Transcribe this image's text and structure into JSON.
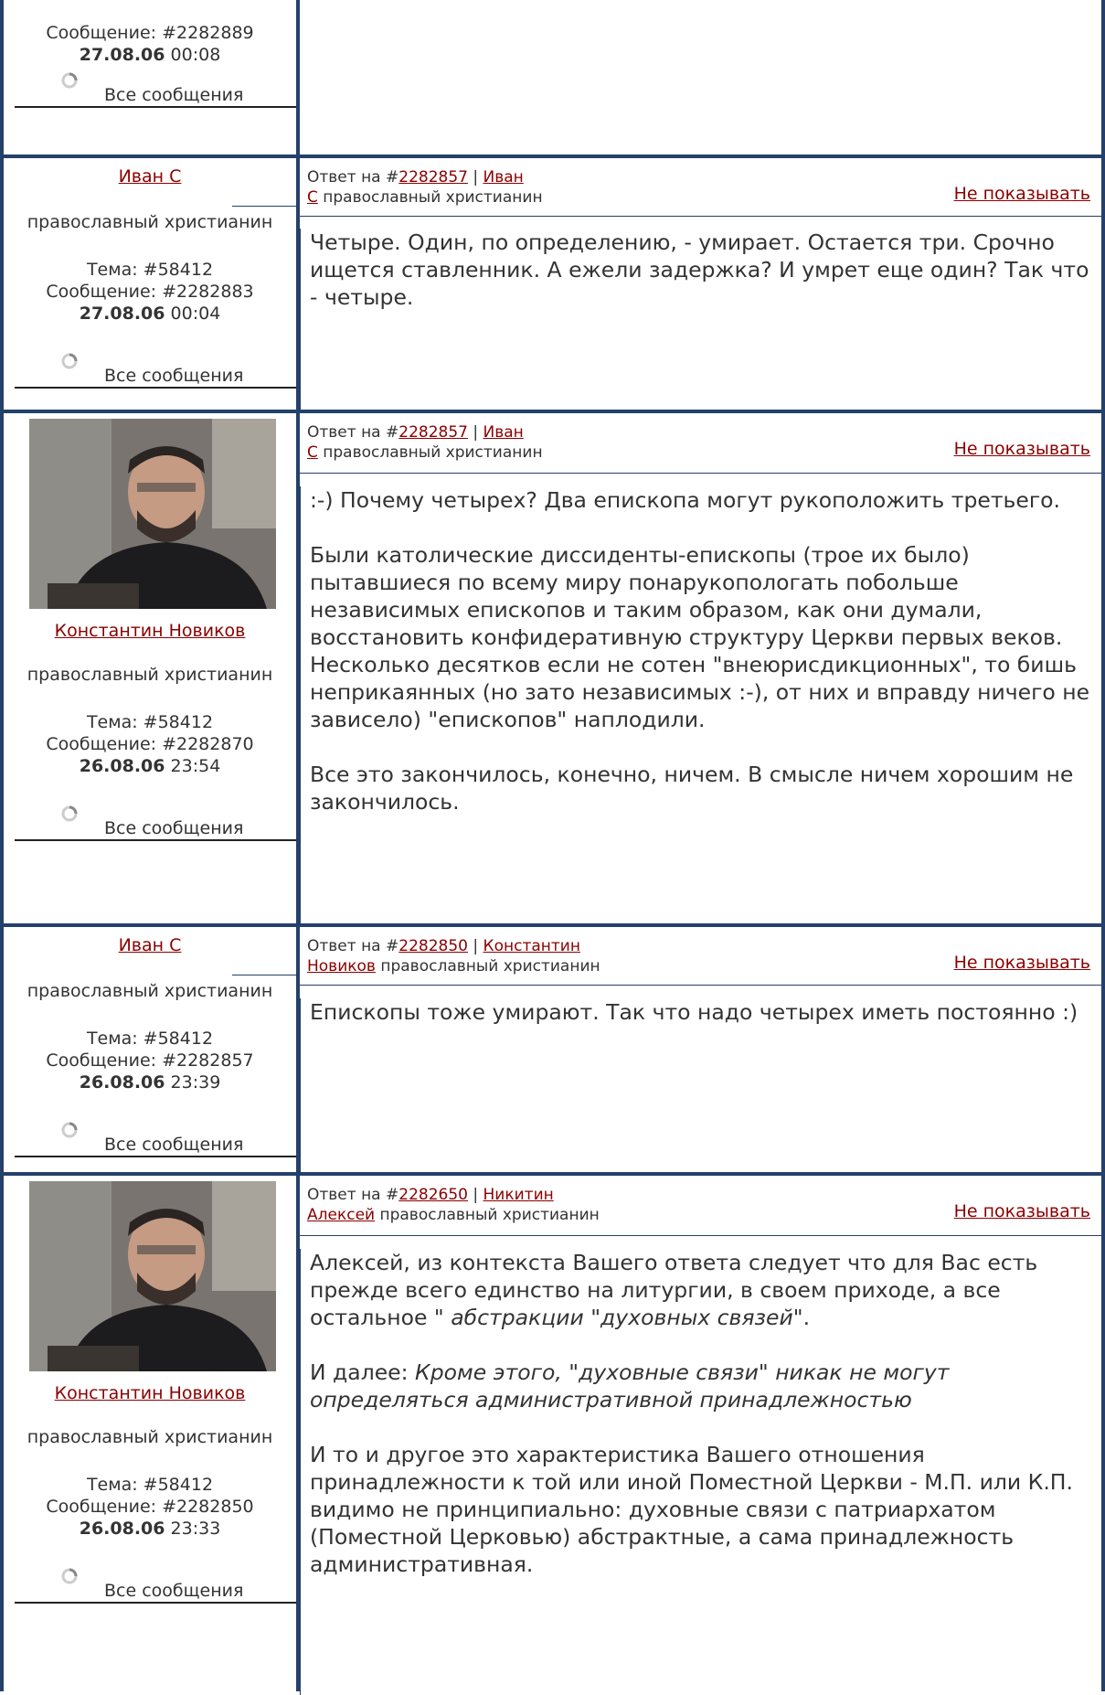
{
  "common": {
    "all_messages": "Все сообщения",
    "hide": "Не показывать",
    "reply_to_prefix": "Ответ на #",
    "role": "православный христианин",
    "topic_prefix": "Тема: #",
    "message_prefix": "Сообщение: #"
  },
  "posts": [
    {
      "message_no": "2282889",
      "date": "27.08.06",
      "time": " 00:08"
    },
    {
      "author": "Иван С",
      "topic": "58412",
      "message_no": "2282883",
      "date": "27.08.06",
      "time": " 00:04",
      "reply_to": "2282857",
      "reply_author_1": "Иван",
      "reply_author_2": "С",
      "reply_role": " православный христианин",
      "body": [
        "Четыре. Один, по определению, - умирает. Остается три. Срочно ищется ставленник. А ежели задержка? И умрет еще один? Так что - четыре."
      ]
    },
    {
      "author": "Константин Новиков",
      "topic": "58412",
      "message_no": "2282870",
      "date": "26.08.06",
      "time": " 23:54",
      "reply_to": "2282857",
      "reply_author_1": "Иван",
      "reply_author_2": "С",
      "reply_role": " православный христианин",
      "body": [
        ":-) Почему четырех? Два епископа могут рукоположить третьего.",
        "Были католические диссиденты-епископы (трое их было) пытавшиеся по всему миру понарукопологать побольше независимых епископов и таким образом, как они думали, восстановить конфидеративную структуру Церкви первых веков. Несколько десятков если не сотен \"внеюрисдикционных\", то бишь неприкаянных (но зато независимых :-), от них и вправду ничего не зависело) \"епископов\" наплодили.",
        "Все это закончилось, конечно, ничем. В смысле ничем хорошим не закончилось."
      ]
    },
    {
      "author": "Иван С",
      "topic": "58412",
      "message_no": "2282857",
      "date": "26.08.06",
      "time": " 23:39",
      "reply_to": "2282850",
      "reply_author_1": "Константин",
      "reply_author_2": "Новиков",
      "reply_role": " православный христианин",
      "body": [
        "Епископы тоже умирают. Так что надо четырех иметь постоянно :)"
      ]
    },
    {
      "author": "Константин Новиков",
      "topic": "58412",
      "message_no": "2282850",
      "date": "26.08.06",
      "time": " 23:33",
      "reply_to": "2282650",
      "reply_author_1": "Никитин",
      "reply_author_2": "Алексей",
      "reply_role": " православный христианин",
      "body_p1": "Алексей, из контекста Вашего ответа следует что для Вас есть прежде всего единство на литургии, в своем приходе, а все остальное \"",
      "body_p1_em": " абстракции \"духовных связей\"",
      "body_p1_end": ".",
      "body_p2": "И далее: ",
      "body_p2_em": "Кроме этого, \"духовные связи\" никак не могут определяться административной принадлежностью",
      "body_p3": "И то и другое это характеристика Вашего отношения принадлежности к той или иной Поместной Церкви - М.П. или К.П. видимо не принципиально: духовные связи с патриархатом (Поместной Церковью) абстрактные, а сама принадлежность административная."
    }
  ]
}
